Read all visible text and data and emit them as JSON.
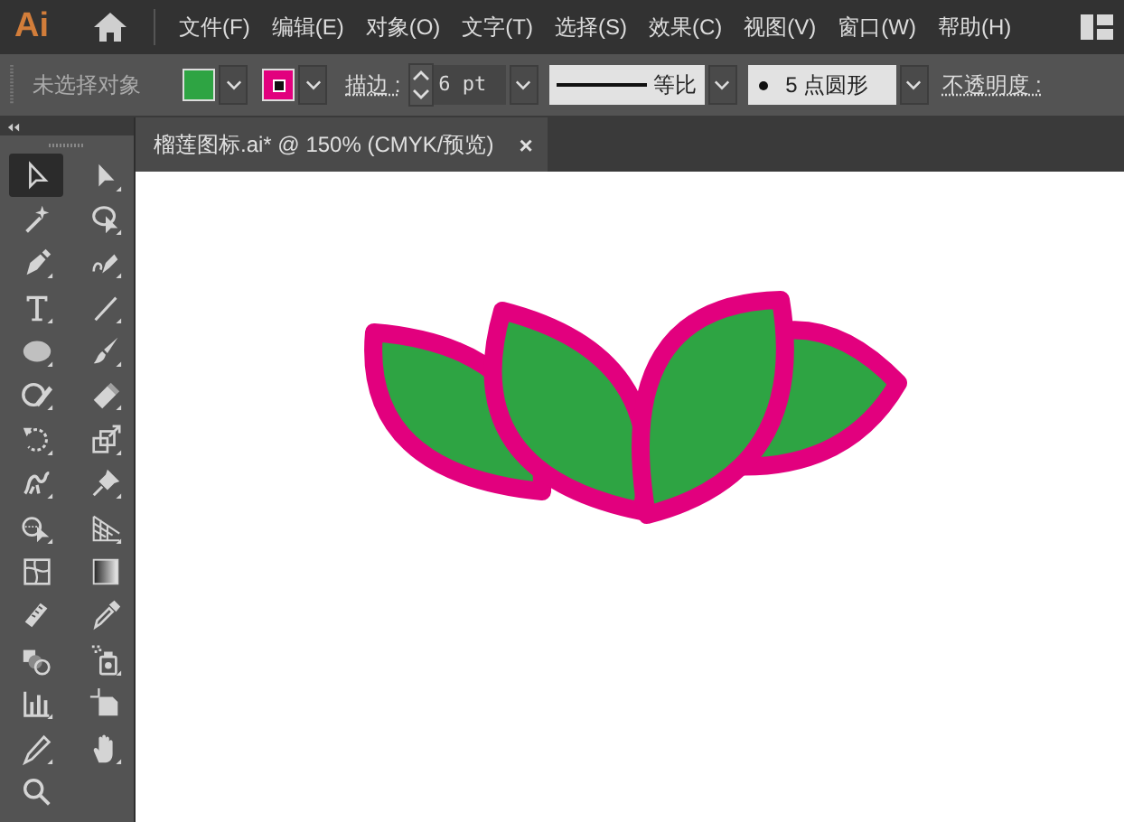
{
  "app": {
    "logo": "Ai"
  },
  "menu": [
    "文件(F)",
    "编辑(E)",
    "对象(O)",
    "文字(T)",
    "选择(S)",
    "效果(C)",
    "视图(V)",
    "窗口(W)",
    "帮助(H)"
  ],
  "control_bar": {
    "selection": "未选择对象",
    "fill_swatch": {
      "color": "#2ea443"
    },
    "stroke_swatch": {
      "color": "#e2007e"
    },
    "stroke_label": "描边 :",
    "stroke_weight": "6 pt",
    "profile": "等比",
    "brush": "5 点圆形",
    "opacity_label": "不透明度 :"
  },
  "document_tab": {
    "title": "榴莲图标.ai* @ 150% (CMYK/预览)",
    "close": "×"
  },
  "tools": [
    {
      "selected": true
    },
    {
      "selected": false
    },
    {
      "selected": false
    },
    {
      "selected": false
    },
    {
      "selected": false
    },
    {
      "selected": false
    },
    {
      "selected": false
    },
    {
      "selected": false
    },
    {
      "selected": false
    },
    {
      "selected": false
    },
    {
      "selected": false
    },
    {
      "selected": false
    },
    {
      "selected": false
    },
    {
      "selected": false
    },
    {
      "selected": false
    },
    {
      "selected": false
    },
    {
      "selected": false
    },
    {
      "selected": false
    },
    {
      "selected": false
    },
    {
      "selected": false
    },
    {
      "selected": false
    },
    {
      "selected": false
    },
    {
      "selected": false
    },
    {
      "selected": false
    },
    {
      "selected": false
    },
    {
      "selected": false
    },
    {
      "selected": false
    },
    {
      "selected": false
    },
    {
      "selected": false
    }
  ]
}
